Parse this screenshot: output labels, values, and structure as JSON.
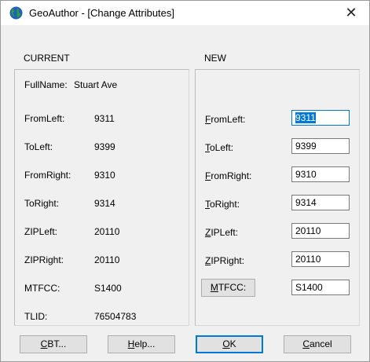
{
  "window": {
    "title": "GeoAuthor - [Change Attributes]",
    "close_glyph": "✕"
  },
  "current": {
    "header": "CURRENT",
    "fullname_label": "FullName:",
    "fullname_value": "Stuart Ave",
    "rows": [
      {
        "label": "FromLeft:",
        "value": "9311"
      },
      {
        "label": "ToLeft:",
        "value": "9399"
      },
      {
        "label": "FromRight:",
        "value": "9310"
      },
      {
        "label": "ToRight:",
        "value": "9314"
      },
      {
        "label": "ZIPLeft:",
        "value": "20110"
      },
      {
        "label": "ZIPRight:",
        "value": "20110"
      },
      {
        "label": "MTFCC:",
        "value": "S1400"
      },
      {
        "label": "TLID:",
        "value": "76504783"
      }
    ]
  },
  "new": {
    "header": "NEW",
    "rows": [
      {
        "accel": "F",
        "rest": "romLeft:",
        "value": "9311"
      },
      {
        "accel": "T",
        "rest": "oLeft:",
        "value": "9399"
      },
      {
        "accel": "F",
        "rest": "romRight:",
        "value": "9310"
      },
      {
        "accel": "T",
        "rest": "oRight:",
        "value": "9314"
      },
      {
        "accel": "Z",
        "rest": "IPLeft:",
        "value": "20110"
      },
      {
        "accel": "Z",
        "rest": "IPRight:",
        "value": "20110"
      }
    ],
    "mtfcc_button": {
      "accel": "M",
      "rest": "TFCC:"
    },
    "mtfcc_value": "S1400"
  },
  "buttons": {
    "cbt": {
      "accel": "C",
      "rest": "BT..."
    },
    "help": {
      "accel": "H",
      "rest": "elp..."
    },
    "ok": {
      "accel": "O",
      "rest": "K"
    },
    "cancel": {
      "accel": "C",
      "rest": "ancel"
    }
  },
  "icon": "globe-icon"
}
